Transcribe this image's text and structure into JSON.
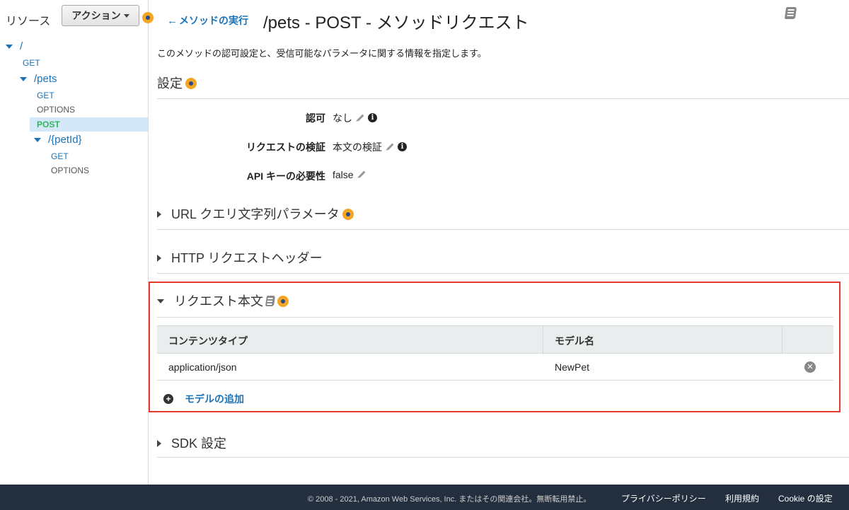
{
  "sidebar": {
    "title": "リソース",
    "action_button": "アクション",
    "tree": [
      {
        "label": "/",
        "kind": "resource"
      },
      {
        "label": "GET",
        "kind": "method"
      },
      {
        "label": "/pets",
        "kind": "resource"
      },
      {
        "label": "GET",
        "kind": "method"
      },
      {
        "label": "OPTIONS",
        "kind": "method"
      },
      {
        "label": "POST",
        "kind": "method",
        "selected": true
      },
      {
        "label": "/{petId}",
        "kind": "resource"
      },
      {
        "label": "GET",
        "kind": "method"
      },
      {
        "label": "OPTIONS",
        "kind": "method"
      }
    ]
  },
  "header": {
    "back_link": "メソッドの実行",
    "title": "/pets - POST - メソッドリクエスト"
  },
  "main": {
    "description": "このメソッドの認可設定と、受信可能なパラメータに関する情報を指定します。",
    "settings": {
      "heading": "設定",
      "fields": [
        {
          "label": "認可",
          "value": "なし"
        },
        {
          "label": "リクエストの検証",
          "value": "本文の検証"
        },
        {
          "label": "API キーの必要性",
          "value": "false"
        }
      ]
    },
    "sections": {
      "url_query": "URL クエリ文字列パラメータ",
      "http_headers": "HTTP リクエストヘッダー",
      "request_body": "リクエスト本文",
      "sdk": "SDK 設定"
    },
    "request_body_table": {
      "columns": [
        "コンテンツタイプ",
        "モデル名"
      ],
      "rows": [
        {
          "content_type": "application/json",
          "model": "NewPet"
        }
      ],
      "add_model": "モデルの追加"
    }
  },
  "footer": {
    "copyright": "© 2008 - 2021, Amazon Web Services, Inc. またはその関連会社。無断転用禁止。",
    "privacy": "プライバシーポリシー",
    "terms": "利用規約",
    "cookie": "Cookie の設定"
  },
  "colors": {
    "accent_link": "#1a73b8",
    "selected_method": "#2eb85c",
    "highlight_border": "#e5392b",
    "footer_bg": "#232f3e",
    "help_dot": "#f5a524"
  }
}
